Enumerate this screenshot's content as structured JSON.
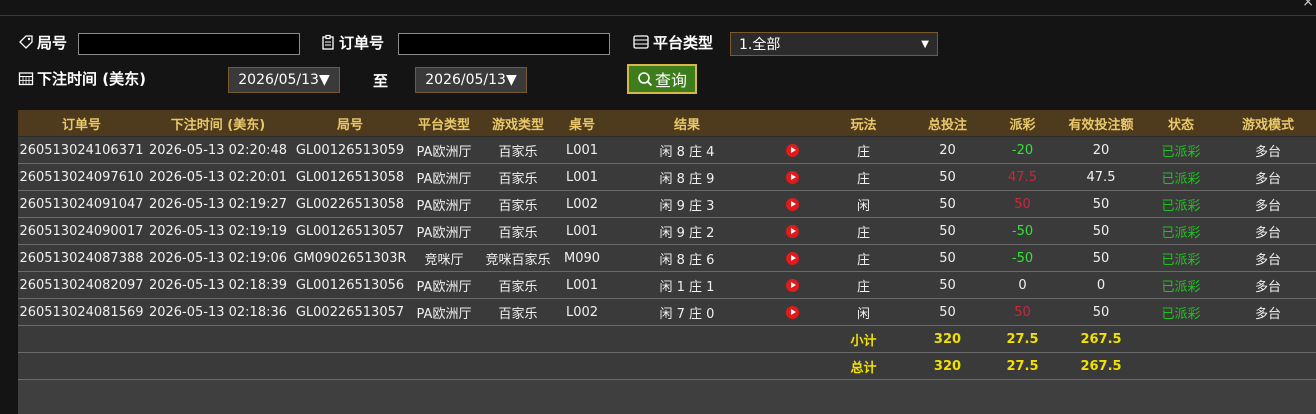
{
  "filters": {
    "round_label": "局号",
    "round_value": "",
    "order_label": "订单号",
    "order_value": "",
    "platform_label": "平台类型",
    "platform_selected": "1.全部",
    "bet_time_label": "下注时间 (美东)",
    "date_from": "2026/05/13▼",
    "to_label": "至",
    "date_to": "2026/05/13▼",
    "query_button": "查询"
  },
  "table": {
    "columns": [
      "订单号",
      "下注时间 (美东)",
      "局号",
      "平台类型",
      "游戏类型",
      "桌号",
      "结果",
      "",
      "玩法",
      "总投注",
      "派彩",
      "有效投注额",
      "状态",
      "游戏模式"
    ],
    "rows": [
      {
        "order": "260513024106371",
        "time": "2026-05-13 02:20:48",
        "round": "GL00126513059",
        "platform": "PA欧洲厅",
        "game": "百家乐",
        "table": "L001",
        "result": "闲 8 庄 4",
        "play": "庄",
        "bet": "20",
        "payout": "-20",
        "payout_color": "green",
        "valid": "20",
        "status": "已派彩",
        "mode": "多台"
      },
      {
        "order": "260513024097610",
        "time": "2026-05-13 02:20:01",
        "round": "GL00126513058",
        "platform": "PA欧洲厅",
        "game": "百家乐",
        "table": "L001",
        "result": "闲 8 庄 9",
        "play": "庄",
        "bet": "50",
        "payout": "47.5",
        "payout_color": "red",
        "valid": "47.5",
        "status": "已派彩",
        "mode": "多台"
      },
      {
        "order": "260513024091047",
        "time": "2026-05-13 02:19:27",
        "round": "GL00226513058",
        "platform": "PA欧洲厅",
        "game": "百家乐",
        "table": "L002",
        "result": "闲 9 庄 3",
        "play": "闲",
        "bet": "50",
        "payout": "50",
        "payout_color": "red",
        "valid": "50",
        "status": "已派彩",
        "mode": "多台"
      },
      {
        "order": "260513024090017",
        "time": "2026-05-13 02:19:19",
        "round": "GL00126513057",
        "platform": "PA欧洲厅",
        "game": "百家乐",
        "table": "L001",
        "result": "闲 9 庄 2",
        "play": "庄",
        "bet": "50",
        "payout": "-50",
        "payout_color": "green",
        "valid": "50",
        "status": "已派彩",
        "mode": "多台"
      },
      {
        "order": "260513024087388",
        "time": "2026-05-13 02:19:06",
        "round": "GM0902651303R",
        "platform": "竞咪厅",
        "game": "竞咪百家乐",
        "table": "M090",
        "result": "闲 8 庄 6",
        "play": "庄",
        "bet": "50",
        "payout": "-50",
        "payout_color": "green",
        "valid": "50",
        "status": "已派彩",
        "mode": "多台"
      },
      {
        "order": "260513024082097",
        "time": "2026-05-13 02:18:39",
        "round": "GL00126513056",
        "platform": "PA欧洲厅",
        "game": "百家乐",
        "table": "L001",
        "result": "闲 1 庄 1",
        "play": "庄",
        "bet": "50",
        "payout": "0",
        "payout_color": "white",
        "valid": "0",
        "status": "已派彩",
        "mode": "多台"
      },
      {
        "order": "260513024081569",
        "time": "2026-05-13 02:18:36",
        "round": "GL00226513057",
        "platform": "PA欧洲厅",
        "game": "百家乐",
        "table": "L002",
        "result": "闲 7 庄 0",
        "play": "闲",
        "bet": "50",
        "payout": "50",
        "payout_color": "red",
        "valid": "50",
        "status": "已派彩",
        "mode": "多台"
      }
    ],
    "subtotal": {
      "label": "小计",
      "bet": "320",
      "payout": "27.5",
      "valid": "267.5"
    },
    "total": {
      "label": "总计",
      "bet": "320",
      "payout": "27.5",
      "valid": "267.5"
    }
  },
  "colors": {
    "accent_gold": "#e8c86a",
    "header_bg": "#4e3a1c",
    "win_green": "#35e03a",
    "loss_red": "#c6283c",
    "total_yellow": "#f2e000"
  },
  "icons": {
    "round": "tag-icon",
    "order": "clipboard-icon",
    "platform": "list-icon",
    "time": "calendar-icon",
    "query": "search-icon",
    "replay": "play-icon"
  }
}
